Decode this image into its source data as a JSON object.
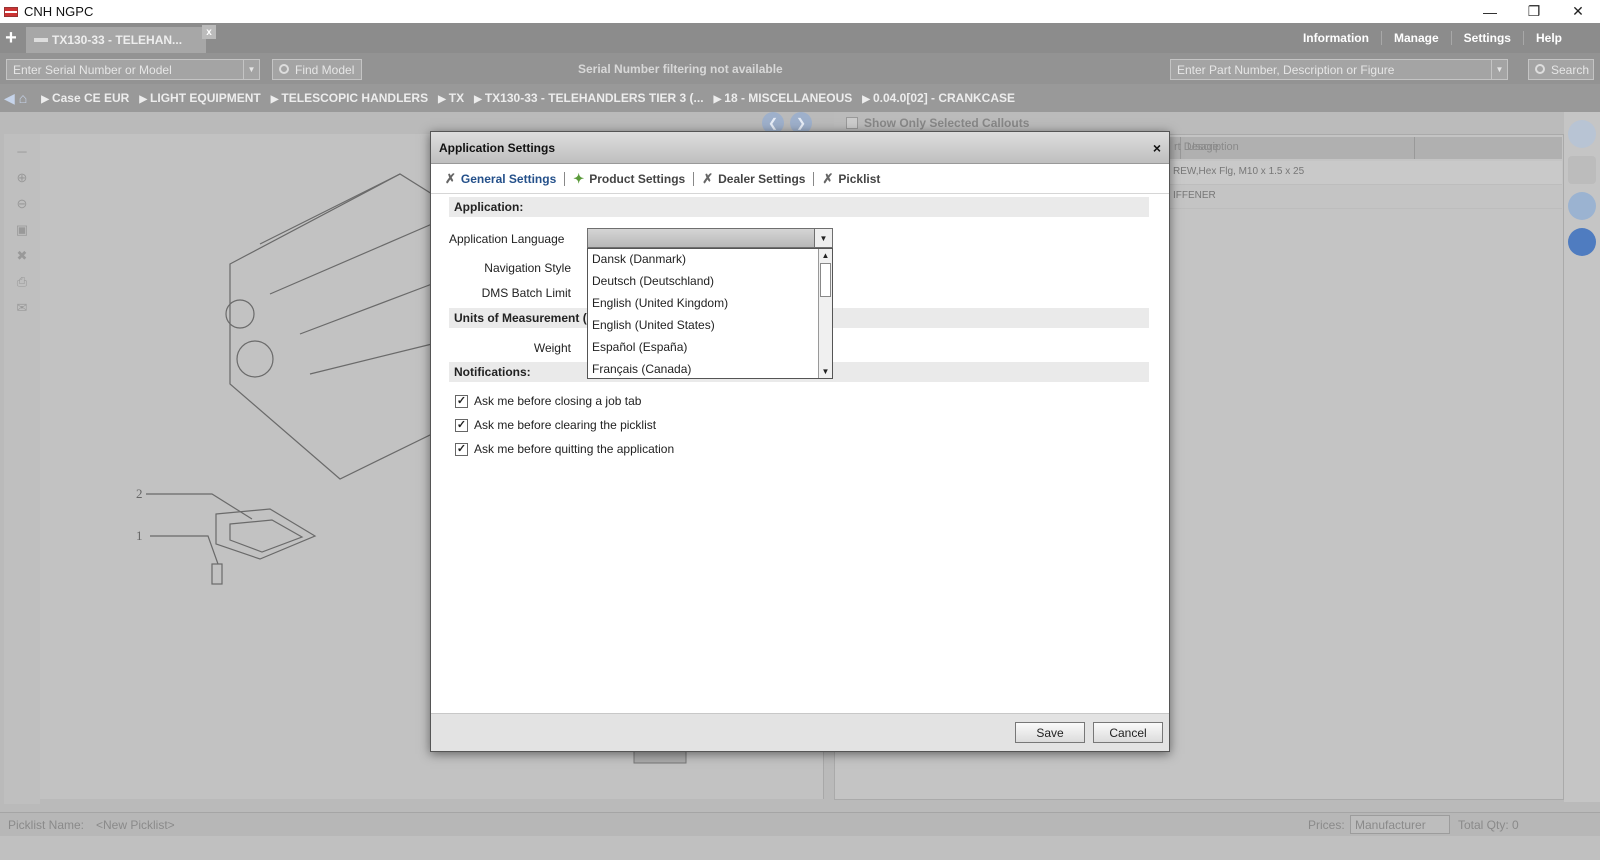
{
  "window": {
    "title": "CNH NGPC",
    "minimize": "—",
    "restore": "❐",
    "close": "✕"
  },
  "tabbar": {
    "add": "+",
    "job_tab": "TX130-33 - TELEHAN...",
    "tab_close": "x",
    "menu": [
      "Information",
      "Manage",
      "Settings",
      "Help"
    ]
  },
  "searchbar": {
    "serial_placeholder": "Enter Serial Number or Model",
    "find_model": "Find Model",
    "filter_msg": "Serial Number filtering not available",
    "part_placeholder": "Enter Part Number, Description or Figure",
    "search": "Search"
  },
  "breadcrumb": [
    "Case CE EUR",
    "LIGHT EQUIPMENT",
    "TELESCOPIC HANDLERS",
    "TX",
    "TX130-33 - TELEHANDLERS TIER 3 (...",
    "18 - MISCELLANEOUS",
    "0.04.0[02] - CRANKCASE"
  ],
  "parts": {
    "show_only": "Show Only Selected Callouts",
    "columns": [
      "rt Description",
      "Usage"
    ],
    "rows": [
      "REW,Hex Flg, M10 x 1.5 x 25",
      "IFFENER"
    ]
  },
  "drawing": {
    "callouts": [
      "2",
      "1"
    ]
  },
  "footer": {
    "picklist_label": "Picklist Name:",
    "picklist_value": "<New Picklist>",
    "prices_label": "Prices:",
    "prices_value": "Manufacturer",
    "total_qty": "Total Qty: 0"
  },
  "dialog": {
    "title": "Application Settings",
    "close": "×",
    "tabs": [
      "General Settings",
      "Product Settings",
      "Dealer Settings",
      "Picklist"
    ],
    "sections": {
      "application": "Application:",
      "units": "Units of Measurement (",
      "notifications": "Notifications:"
    },
    "labels": {
      "language": "Application Language",
      "nav_style": "Navigation Style",
      "dms_batch": "DMS Batch Limit",
      "weight": "Weight"
    },
    "language_options": [
      "Dansk (Danmark)",
      "Deutsch (Deutschland)",
      "English (United Kingdom)",
      "English (United States)",
      "Español (España)",
      "Français (Canada)"
    ],
    "checkboxes": [
      {
        "label": "Ask me before closing a job tab",
        "checked": true
      },
      {
        "label": "Ask me before clearing the picklist",
        "checked": true
      },
      {
        "label": "Ask me before quitting the application",
        "checked": true
      }
    ],
    "save": "Save",
    "cancel": "Cancel"
  },
  "colors": {
    "accent": "#24508a",
    "toolbar": "#8c8c8c"
  }
}
